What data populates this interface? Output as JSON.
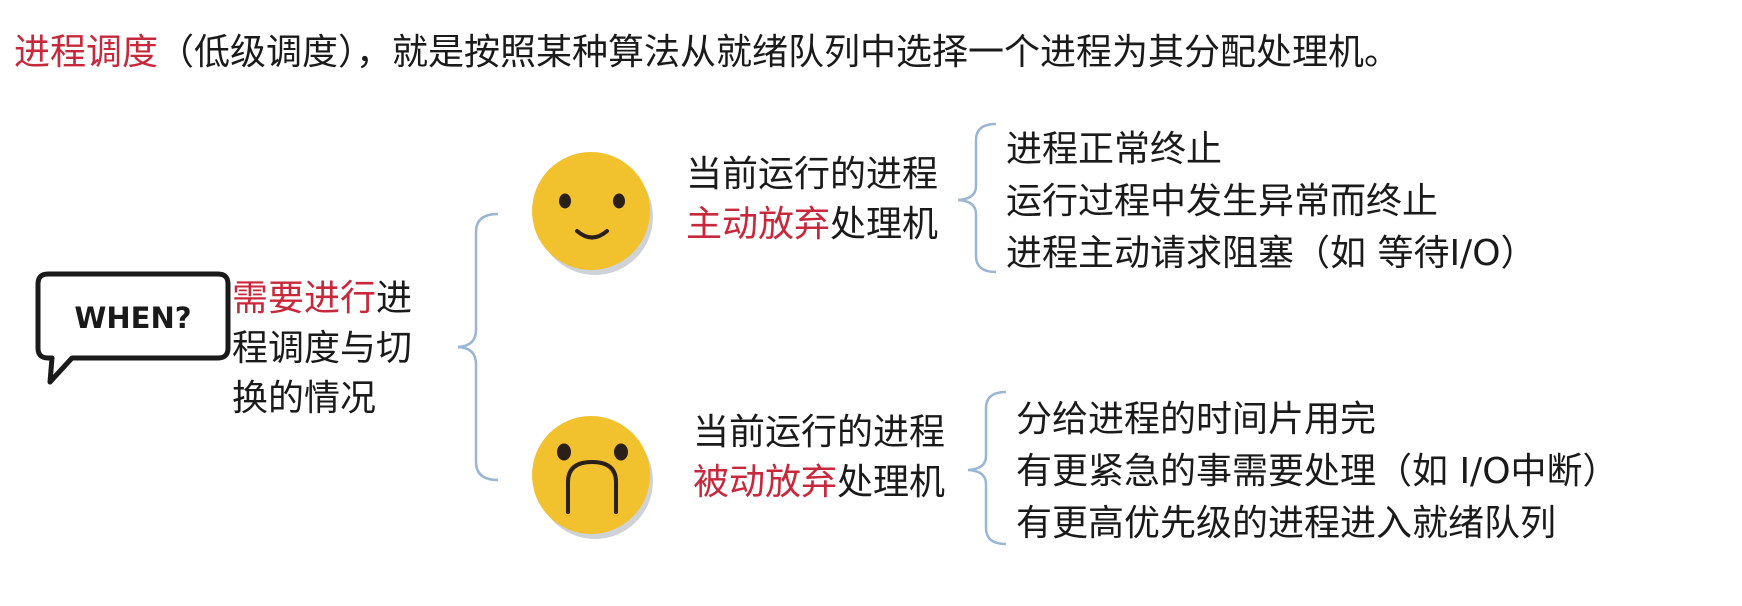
{
  "title": {
    "highlight": "进程调度",
    "rest": "（低级调度），就是按照某种算法从就绪队列中选择一个进程为其分配处理机。"
  },
  "when_badge": "WHEN?",
  "root": {
    "highlight": "需要进行",
    "rest": "进程调度与切换的情况"
  },
  "branches": [
    {
      "face": "smiley-face",
      "prefix": "当前运行的进程",
      "highlight": "主动放弃",
      "suffix": "处理机",
      "items": [
        "进程正常终止",
        "运行过程中发生异常而终止",
        "进程主动请求阻塞（如 等待I/O）"
      ]
    },
    {
      "face": "frowning-face",
      "prefix": "当前运行的进程",
      "highlight": "被动放弃",
      "suffix": "处理机",
      "items": [
        "分给进程的时间片用完",
        "有更紧急的事需要处理（如 I/O中断）",
        "有更高优先级的进程进入就绪队列"
      ]
    }
  ],
  "colors": {
    "highlight": "#c8283c",
    "brace": "#9ab6d3",
    "face": "#f2c12e",
    "face_shadow": "#cfd3d8"
  }
}
